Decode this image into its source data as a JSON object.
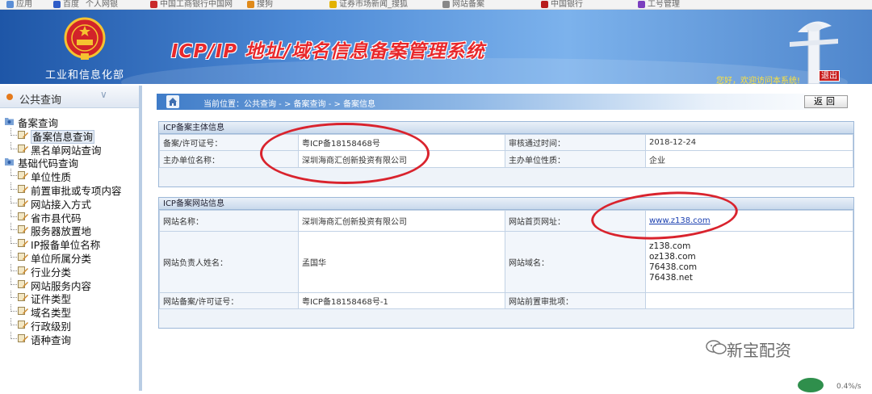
{
  "bookmarks": [
    {
      "label": "应用",
      "color": "#5b8ed6"
    },
    {
      "label": "百度",
      "color": "#2e5cc7"
    },
    {
      "label": "个人网银",
      "color": "#d44"
    },
    {
      "label": "中国工商银行中国网",
      "color": "#c92a2a"
    },
    {
      "label": "搜狗",
      "color": "#e08a1a"
    },
    {
      "label": "证券市场新闻_搜狐",
      "color": "#e3b200"
    },
    {
      "label": "网站备案",
      "color": "#888"
    },
    {
      "label": "中国银行",
      "color": "#b71c1c"
    },
    {
      "label": "工号管理",
      "color": "#7b3fbf"
    }
  ],
  "header": {
    "ministry": "工业和信息化部",
    "title": "ICP/IP 地址/域名信息备案管理系统",
    "welcome": "您好，欢迎访问本系统!",
    "logout": "退出"
  },
  "sidebar": {
    "title": "公共查询",
    "tree": [
      {
        "label": "备案查询",
        "level": "root"
      },
      {
        "label": "备案信息查询",
        "level": "child",
        "selected": true
      },
      {
        "label": "黑名单网站查询",
        "level": "child"
      },
      {
        "label": "基础代码查询",
        "level": "root"
      },
      {
        "label": "单位性质",
        "level": "child"
      },
      {
        "label": "前置审批或专项内容",
        "level": "child"
      },
      {
        "label": "网站接入方式",
        "level": "child"
      },
      {
        "label": "省市县代码",
        "level": "child"
      },
      {
        "label": "服务器放置地",
        "level": "child"
      },
      {
        "label": "IP报备单位名称",
        "level": "child"
      },
      {
        "label": "单位所属分类",
        "level": "child"
      },
      {
        "label": "行业分类",
        "level": "child"
      },
      {
        "label": "网站服务内容",
        "level": "child"
      },
      {
        "label": "证件类型",
        "level": "child"
      },
      {
        "label": "域名类型",
        "level": "child"
      },
      {
        "label": "行政级别",
        "level": "child"
      },
      {
        "label": "语种查询",
        "level": "child"
      }
    ]
  },
  "breadcrumb": "当前位置：公共查询  - >  备案查询  - >  备案信息",
  "back_button": "返回",
  "entity_panel": {
    "title": "ICP备案主体信息",
    "rows": [
      {
        "l1": "备案/许可证号：",
        "v1": "粤ICP备18158468号",
        "l2": "审核通过时间：",
        "v2": "2018-12-24"
      },
      {
        "l1": "主办单位名称：",
        "v1": "深圳海商汇创新投资有限公司",
        "l2": "主办单位性质：",
        "v2": "企业"
      }
    ]
  },
  "site_panel": {
    "title": "ICP备案网站信息",
    "site_name_label": "网站名称：",
    "site_name": "深圳海商汇创新投资有限公司",
    "homepage_label": "网站首页网址：",
    "homepage": "www.z138.com",
    "owner_label": "网站负责人姓名：",
    "owner": "孟国华",
    "domain_label": "网站域名：",
    "domains": [
      "z138.com",
      "oz138.com",
      "76438.com",
      "76438.net"
    ],
    "license_label": "网站备案/许可证号：",
    "license": "粤ICP备18158468号-1",
    "preapproval_label": "网站前置审批项：",
    "preapproval": ""
  },
  "watermark": "新宝配资",
  "corner_text": "0.4%/s"
}
